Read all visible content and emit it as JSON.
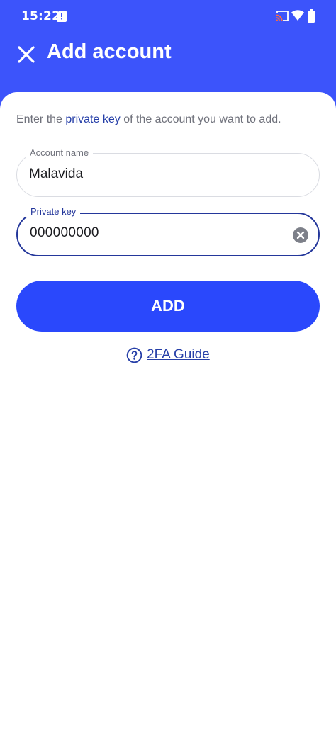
{
  "status_bar": {
    "time": "15:22",
    "icons": [
      "sd-card-icon",
      "cast-icon",
      "wifi-icon",
      "battery-icon"
    ]
  },
  "header": {
    "title": "Add account",
    "close_icon": "close-icon"
  },
  "instructions": {
    "prefix": "Enter the ",
    "highlight": "private key",
    "suffix": " of the account you want to add."
  },
  "form": {
    "account_name": {
      "label": "Account name",
      "value": "Malavida"
    },
    "private_key": {
      "label": "Private key",
      "value": "000000000"
    }
  },
  "add_button": {
    "label": "ADD"
  },
  "guide_link": {
    "label": "2FA Guide",
    "icon": "help-circle-icon"
  },
  "colors": {
    "header_bg": "#3c54fb",
    "button_bg": "#2a48fc",
    "accent_text": "#263fa8",
    "focused_border": "#24379b",
    "muted_text": "#6f717b"
  }
}
